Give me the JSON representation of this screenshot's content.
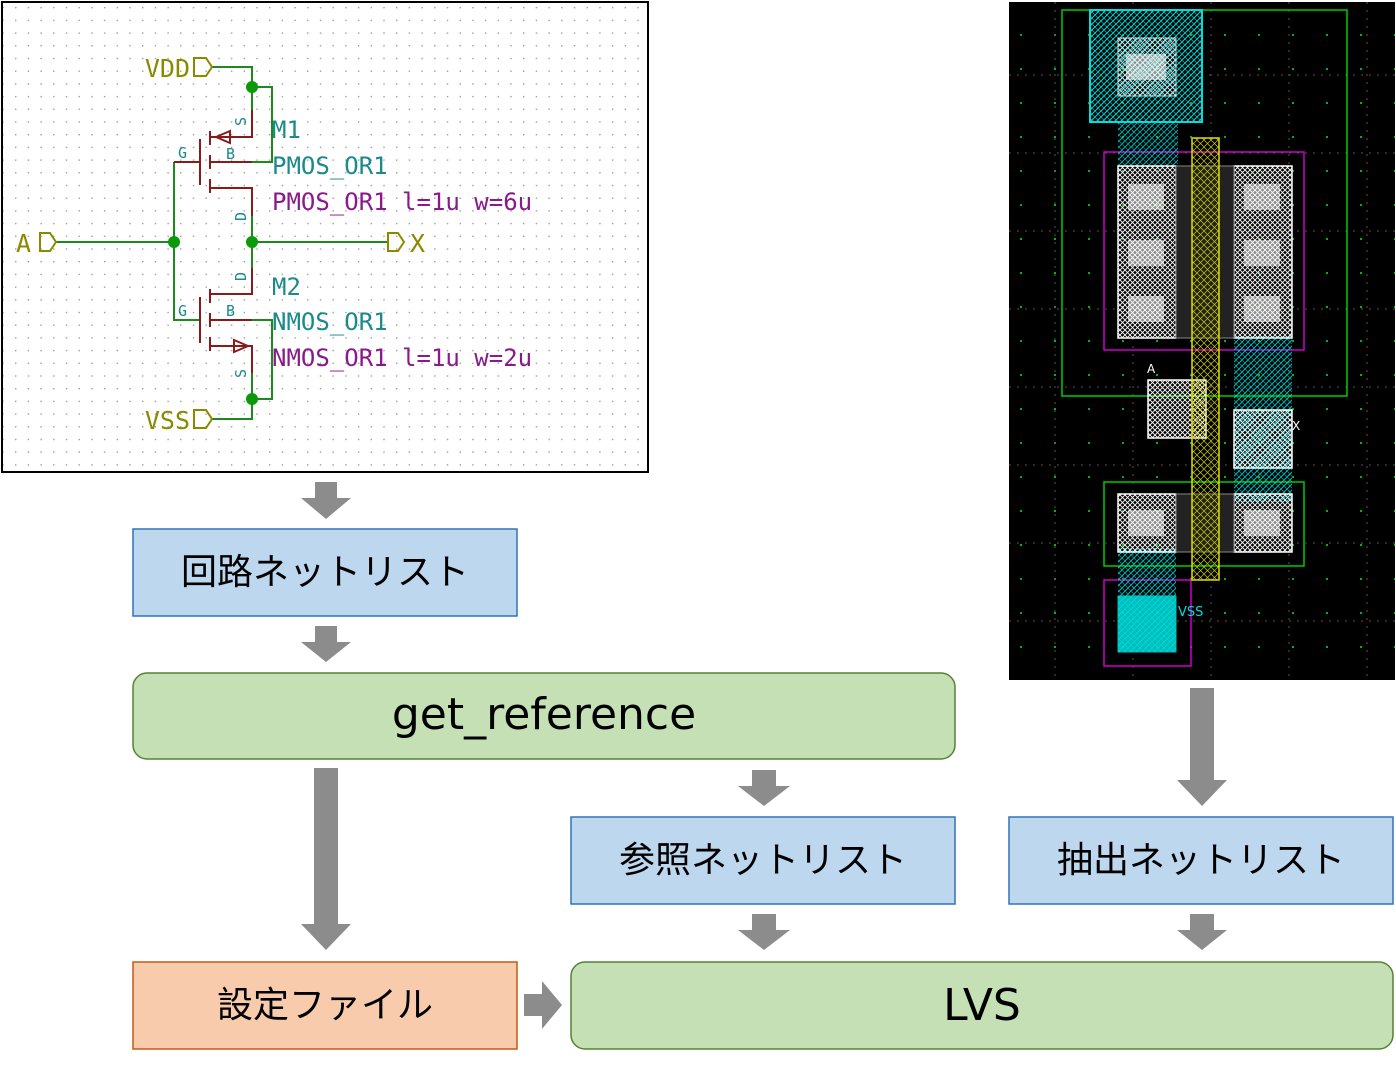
{
  "schematic": {
    "ports": {
      "vdd": "VDD",
      "vss": "VSS",
      "input": "A",
      "output": "X"
    },
    "m1": {
      "name": "M1",
      "model": "PMOS_OR1",
      "params": "PMOS_OR1 l=1u w=6u"
    },
    "m2": {
      "name": "M2",
      "model": "NMOS_OR1",
      "params": "NMOS_OR1 l=1u w=2u"
    },
    "pins": {
      "gate": "G",
      "bulk": "B",
      "drain": "D",
      "source": "S"
    },
    "colors": {
      "wire": "#1c8a1c",
      "junction": "#0a9a0a",
      "port": "#8a8a00",
      "device": "#8b1a1a",
      "ref": "#1a8a8a",
      "value": "#8a1a8a"
    }
  },
  "layout_view": {
    "labels": {
      "a": "A",
      "x": "X",
      "vss": "VSS"
    },
    "colors": {
      "background": "#000000",
      "nwell": "#00cc00",
      "select": "#cc00cc",
      "metal": "#00dddd",
      "poly": "#dddd00",
      "contact": "#ffffff"
    }
  },
  "flow": {
    "circuit_netlist": "回路ネットリスト",
    "get_reference": "get_reference",
    "reference_netlist": "参照ネットリスト",
    "extracted_netlist": "抽出ネットリスト",
    "config_file": "設定ファイル",
    "lvs": "LVS",
    "colors": {
      "blue_box": "#bdd7ee",
      "green_box": "#c5e0b4",
      "orange_box": "#f8cbad",
      "arrow": "#8c8c8c"
    }
  }
}
